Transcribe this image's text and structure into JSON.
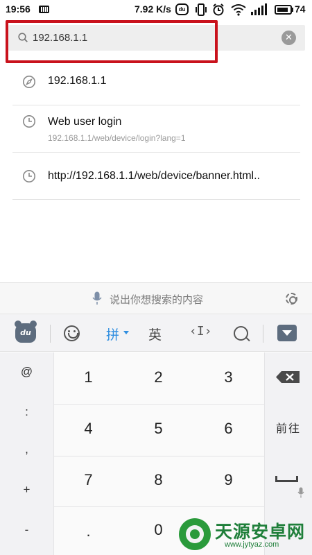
{
  "status_bar": {
    "time": "19:56",
    "net_speed": "7.92 K/s",
    "du_badge": "du",
    "battery": "74"
  },
  "address_bar": {
    "query": "192.168.1.1"
  },
  "suggestions": [
    {
      "icon": "compass-icon",
      "title": "192.168.1.1",
      "subtitle": ""
    },
    {
      "icon": "clock-icon",
      "title": "Web user login",
      "subtitle": "192.168.1.1/web/device/login?lang=1"
    },
    {
      "icon": "clock-icon",
      "title": "http://192.168.1.1/web/device/banner.html..",
      "subtitle": ""
    }
  ],
  "voice_bar": {
    "hint": "说出你想搜索的内容"
  },
  "keyboard_toolbar": {
    "logo_text": "du",
    "pinyin_label": "拼",
    "english_label": "英",
    "cursor_label": "‹I›"
  },
  "keypad": {
    "symbols": [
      "@",
      ":",
      ",",
      "+",
      "-"
    ],
    "digits": [
      "1",
      "2",
      "3",
      "4",
      "5",
      "6",
      "7",
      "8",
      "9",
      ".",
      "0"
    ],
    "go_label": "前往"
  },
  "watermark": {
    "brand": "天源安卓网",
    "url": "www.jytyaz.com"
  }
}
